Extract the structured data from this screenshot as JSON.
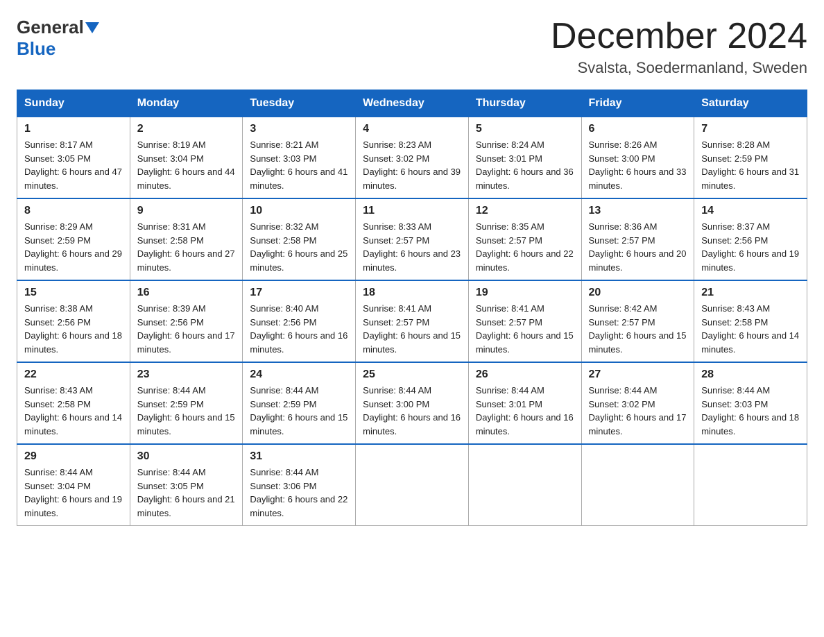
{
  "logo": {
    "general": "General",
    "blue": "Blue"
  },
  "title": "December 2024",
  "location": "Svalsta, Soedermanland, Sweden",
  "days_of_week": [
    "Sunday",
    "Monday",
    "Tuesday",
    "Wednesday",
    "Thursday",
    "Friday",
    "Saturday"
  ],
  "weeks": [
    [
      {
        "num": "1",
        "sunrise": "8:17 AM",
        "sunset": "3:05 PM",
        "daylight": "6 hours and 47 minutes."
      },
      {
        "num": "2",
        "sunrise": "8:19 AM",
        "sunset": "3:04 PM",
        "daylight": "6 hours and 44 minutes."
      },
      {
        "num": "3",
        "sunrise": "8:21 AM",
        "sunset": "3:03 PM",
        "daylight": "6 hours and 41 minutes."
      },
      {
        "num": "4",
        "sunrise": "8:23 AM",
        "sunset": "3:02 PM",
        "daylight": "6 hours and 39 minutes."
      },
      {
        "num": "5",
        "sunrise": "8:24 AM",
        "sunset": "3:01 PM",
        "daylight": "6 hours and 36 minutes."
      },
      {
        "num": "6",
        "sunrise": "8:26 AM",
        "sunset": "3:00 PM",
        "daylight": "6 hours and 33 minutes."
      },
      {
        "num": "7",
        "sunrise": "8:28 AM",
        "sunset": "2:59 PM",
        "daylight": "6 hours and 31 minutes."
      }
    ],
    [
      {
        "num": "8",
        "sunrise": "8:29 AM",
        "sunset": "2:59 PM",
        "daylight": "6 hours and 29 minutes."
      },
      {
        "num": "9",
        "sunrise": "8:31 AM",
        "sunset": "2:58 PM",
        "daylight": "6 hours and 27 minutes."
      },
      {
        "num": "10",
        "sunrise": "8:32 AM",
        "sunset": "2:58 PM",
        "daylight": "6 hours and 25 minutes."
      },
      {
        "num": "11",
        "sunrise": "8:33 AM",
        "sunset": "2:57 PM",
        "daylight": "6 hours and 23 minutes."
      },
      {
        "num": "12",
        "sunrise": "8:35 AM",
        "sunset": "2:57 PM",
        "daylight": "6 hours and 22 minutes."
      },
      {
        "num": "13",
        "sunrise": "8:36 AM",
        "sunset": "2:57 PM",
        "daylight": "6 hours and 20 minutes."
      },
      {
        "num": "14",
        "sunrise": "8:37 AM",
        "sunset": "2:56 PM",
        "daylight": "6 hours and 19 minutes."
      }
    ],
    [
      {
        "num": "15",
        "sunrise": "8:38 AM",
        "sunset": "2:56 PM",
        "daylight": "6 hours and 18 minutes."
      },
      {
        "num": "16",
        "sunrise": "8:39 AM",
        "sunset": "2:56 PM",
        "daylight": "6 hours and 17 minutes."
      },
      {
        "num": "17",
        "sunrise": "8:40 AM",
        "sunset": "2:56 PM",
        "daylight": "6 hours and 16 minutes."
      },
      {
        "num": "18",
        "sunrise": "8:41 AM",
        "sunset": "2:57 PM",
        "daylight": "6 hours and 15 minutes."
      },
      {
        "num": "19",
        "sunrise": "8:41 AM",
        "sunset": "2:57 PM",
        "daylight": "6 hours and 15 minutes."
      },
      {
        "num": "20",
        "sunrise": "8:42 AM",
        "sunset": "2:57 PM",
        "daylight": "6 hours and 15 minutes."
      },
      {
        "num": "21",
        "sunrise": "8:43 AM",
        "sunset": "2:58 PM",
        "daylight": "6 hours and 14 minutes."
      }
    ],
    [
      {
        "num": "22",
        "sunrise": "8:43 AM",
        "sunset": "2:58 PM",
        "daylight": "6 hours and 14 minutes."
      },
      {
        "num": "23",
        "sunrise": "8:44 AM",
        "sunset": "2:59 PM",
        "daylight": "6 hours and 15 minutes."
      },
      {
        "num": "24",
        "sunrise": "8:44 AM",
        "sunset": "2:59 PM",
        "daylight": "6 hours and 15 minutes."
      },
      {
        "num": "25",
        "sunrise": "8:44 AM",
        "sunset": "3:00 PM",
        "daylight": "6 hours and 16 minutes."
      },
      {
        "num": "26",
        "sunrise": "8:44 AM",
        "sunset": "3:01 PM",
        "daylight": "6 hours and 16 minutes."
      },
      {
        "num": "27",
        "sunrise": "8:44 AM",
        "sunset": "3:02 PM",
        "daylight": "6 hours and 17 minutes."
      },
      {
        "num": "28",
        "sunrise": "8:44 AM",
        "sunset": "3:03 PM",
        "daylight": "6 hours and 18 minutes."
      }
    ],
    [
      {
        "num": "29",
        "sunrise": "8:44 AM",
        "sunset": "3:04 PM",
        "daylight": "6 hours and 19 minutes."
      },
      {
        "num": "30",
        "sunrise": "8:44 AM",
        "sunset": "3:05 PM",
        "daylight": "6 hours and 21 minutes."
      },
      {
        "num": "31",
        "sunrise": "8:44 AM",
        "sunset": "3:06 PM",
        "daylight": "6 hours and 22 minutes."
      },
      null,
      null,
      null,
      null
    ]
  ]
}
